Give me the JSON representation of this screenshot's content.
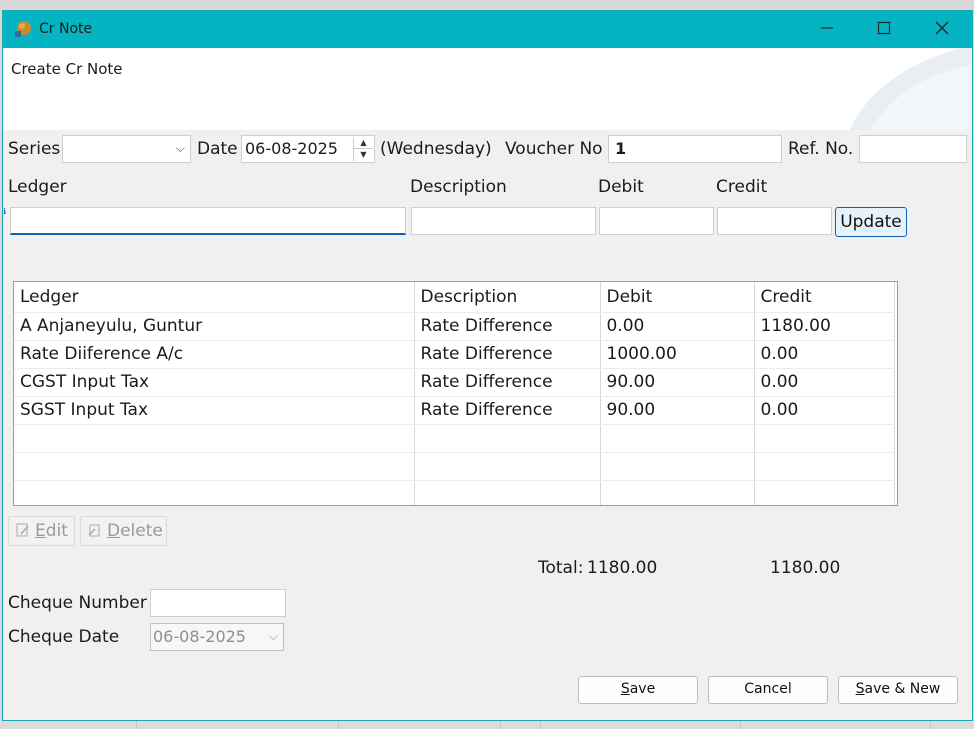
{
  "window": {
    "title": "Cr Note",
    "minimize_icon": "minimize-icon",
    "maximize_icon": "maximize-icon",
    "close_icon": "close-icon"
  },
  "header": {
    "title": "Create Cr Note"
  },
  "form": {
    "series_label": "Series",
    "series_value": "",
    "date_label": "Date",
    "date_value": "06-08-2025",
    "weekday": "(Wednesday)",
    "voucher_label": "Voucher No",
    "voucher_value": "1",
    "ref_label": "Ref. No.",
    "ref_value": ""
  },
  "entry": {
    "ledger_label": "Ledger",
    "description_label": "Description",
    "debit_label": "Debit",
    "credit_label": "Credit",
    "ledger_value": "",
    "description_value": "",
    "debit_value": "",
    "credit_value": "",
    "update_button": "Update"
  },
  "grid": {
    "columns": [
      "Ledger",
      "Description",
      "Debit",
      "Credit"
    ],
    "rows": [
      [
        "A Anjaneyulu, Guntur",
        "Rate Difference",
        "0.00",
        "1180.00"
      ],
      [
        "Rate Diiference A/c",
        "Rate Difference",
        "1000.00",
        "0.00"
      ],
      [
        "CGST Input Tax",
        "Rate Difference",
        "90.00",
        "0.00"
      ],
      [
        "SGST Input Tax",
        "Rate Difference",
        "90.00",
        "0.00"
      ],
      [
        "",
        "",
        "",
        ""
      ],
      [
        "",
        "",
        "",
        ""
      ],
      [
        "",
        "",
        "",
        ""
      ]
    ]
  },
  "actions": {
    "edit_prefix": "",
    "edit_underlined": "E",
    "edit_rest": "dit",
    "delete_underlined": "D",
    "delete_rest": "elete"
  },
  "totals": {
    "label": "Total:",
    "debit": "1180.00",
    "credit": "1180.00"
  },
  "cheque": {
    "number_label": "Cheque Number",
    "number_value": "",
    "date_label": "Cheque Date",
    "date_value": "06-08-2025"
  },
  "footer": {
    "save_underlined": "S",
    "save_rest": "ave",
    "cancel": "Cancel",
    "save_new_underlined": "S",
    "save_new_rest": "ave & New"
  },
  "colors": {
    "titlebar": "#05b4c2",
    "focus": "#0a62b8"
  }
}
